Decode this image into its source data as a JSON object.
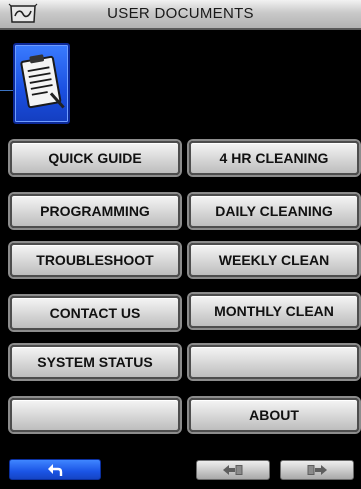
{
  "header": {
    "title": "USER DOCUMENTS",
    "logo_icon": "brand-logo-icon"
  },
  "document_tile": {
    "icon": "clipboard-document-icon",
    "color": "#1a4fe0"
  },
  "menu": {
    "left": [
      {
        "label": "QUICK GUIDE",
        "name": "quick-guide-button"
      },
      {
        "label": "PROGRAMMING",
        "name": "programming-button"
      },
      {
        "label": "TROUBLESHOOT",
        "name": "troubleshoot-button"
      },
      {
        "label": "CONTACT US",
        "name": "contact-us-button"
      },
      {
        "label": "SYSTEM STATUS",
        "name": "system-status-button"
      },
      {
        "label": "",
        "name": "blank-button-left"
      }
    ],
    "right": [
      {
        "label": "4 HR CLEANING",
        "name": "4hr-cleaning-button"
      },
      {
        "label": "DAILY CLEANING",
        "name": "daily-cleaning-button"
      },
      {
        "label": "WEEKLY CLEAN",
        "name": "weekly-clean-button"
      },
      {
        "label": "MONTHLY CLEAN",
        "name": "monthly-clean-button"
      },
      {
        "label": "",
        "name": "blank-button-right"
      },
      {
        "label": "ABOUT",
        "name": "about-button"
      }
    ]
  },
  "footer": {
    "back_icon": "back-arrow-icon",
    "prev_icon": "prev-page-icon",
    "next_icon": "next-page-icon"
  },
  "colors": {
    "accent_blue": "#1b55e6",
    "button_gray": "#d9d9d9",
    "background": "#000000"
  }
}
